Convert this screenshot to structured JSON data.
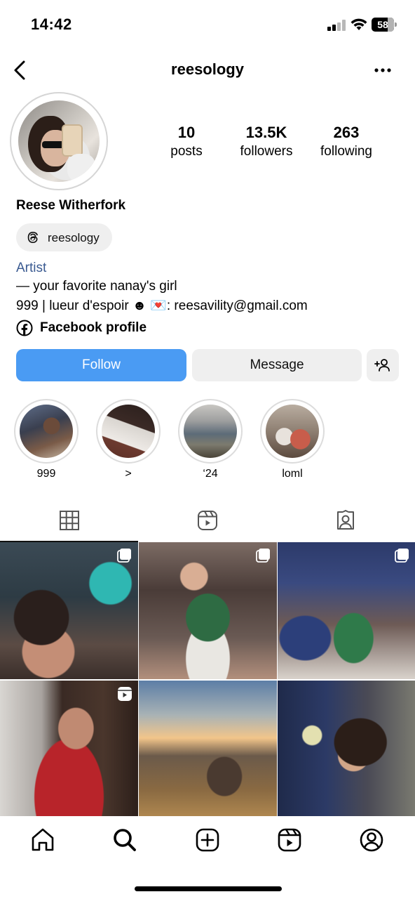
{
  "status_bar": {
    "time": "14:42",
    "battery": "58"
  },
  "header": {
    "username": "reesology"
  },
  "profile": {
    "posts_count": "10",
    "posts_label": "posts",
    "followers_count": "13.5K",
    "followers_label": "followers",
    "following_count": "263",
    "following_label": "following",
    "display_name": "Reese Witherfork",
    "threads_handle": "reesology",
    "category": "Artist",
    "bio_lines": [
      "— your favorite nanay's girl",
      "999 | lueur d'espoir ☻ 💌: reesavility@gmail.com"
    ],
    "facebook_label": "Facebook profile"
  },
  "actions": {
    "follow_label": "Follow",
    "message_label": "Message"
  },
  "highlights": [
    {
      "label": "999"
    },
    {
      "label": ">"
    },
    {
      "label": "‘24"
    },
    {
      "label": "loml"
    }
  ],
  "tabs": [
    {
      "icon": "grid-icon",
      "active": true
    },
    {
      "icon": "reels-icon",
      "active": false
    },
    {
      "icon": "tagged-icon",
      "active": false
    }
  ],
  "bottom_nav": [
    "home-icon",
    "search-icon",
    "create-icon",
    "reels-icon",
    "profile-icon"
  ],
  "colors": {
    "follow_button": "#4a9bf3",
    "secondary_button": "#efefef",
    "category_text": "#3a5a91"
  }
}
